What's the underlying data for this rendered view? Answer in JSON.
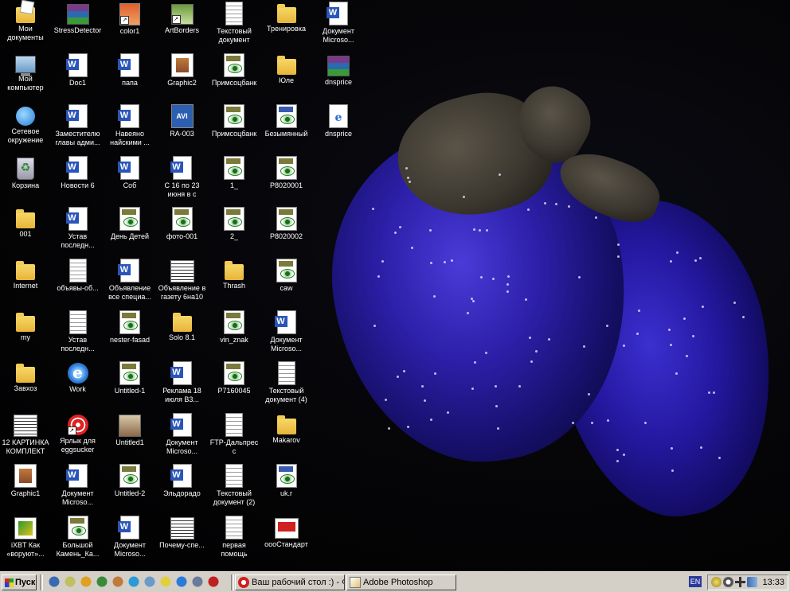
{
  "desktop": {
    "icons": [
      {
        "label": "Мои документы",
        "icon": "my-documents-icon"
      },
      {
        "label": "Мой компьютер",
        "icon": "my-computer-icon"
      },
      {
        "label": "Сетевое окружение",
        "icon": "network-places-icon"
      },
      {
        "label": "Корзина",
        "icon": "recycle-bin-icon"
      },
      {
        "label": "001",
        "icon": "folder-icon"
      },
      {
        "label": "Internet",
        "icon": "folder-icon"
      },
      {
        "label": "my",
        "icon": "folder-icon"
      },
      {
        "label": "Завхоз",
        "icon": "folder-icon"
      },
      {
        "label": "12 КАРТИНКА КОМПЛЕКТ",
        "icon": "image-file-icon"
      },
      {
        "label": "Graphic1",
        "icon": "photoshop-file-icon"
      },
      {
        "label": "iXBT Как «воруют»...",
        "icon": "ixbt-file-icon"
      },
      {
        "label": "StressDetector",
        "icon": "winrar-archive-icon"
      },
      {
        "label": "Doc1",
        "icon": "word-document-icon"
      },
      {
        "label": "Заместителю главы адми...",
        "icon": "word-document-icon"
      },
      {
        "label": "Новости 6",
        "icon": "word-document-icon"
      },
      {
        "label": "Устав последн...",
        "icon": "word-document-icon"
      },
      {
        "label": "объявы-об...",
        "icon": "text-document-icon"
      },
      {
        "label": "Устав последн...",
        "icon": "text-document-icon"
      },
      {
        "label": "Work",
        "icon": "internet-explorer-icon"
      },
      {
        "label": "Ярлык для eggsucker",
        "icon": "ball-shortcut-icon"
      },
      {
        "label": "Документ Microso...",
        "icon": "word-document-icon"
      },
      {
        "label": "Большой Камень_Ка...",
        "icon": "tiff-image-icon"
      },
      {
        "label": "color1",
        "icon": "color-file-icon"
      },
      {
        "label": "папа",
        "icon": "word-document-icon"
      },
      {
        "label": "Навеяно найскими ...",
        "icon": "word-document-icon"
      },
      {
        "label": "Соб",
        "icon": "word-document-icon"
      },
      {
        "label": "День Детей",
        "icon": "tiff-image-icon"
      },
      {
        "label": "Объявление все специа...",
        "icon": "word-document-icon"
      },
      {
        "label": "nester-fasad",
        "icon": "tiff-image-icon"
      },
      {
        "label": "Untitled-1",
        "icon": "psd-image-icon"
      },
      {
        "label": "Untitled1",
        "icon": "project-file-icon"
      },
      {
        "label": "Untitled-2",
        "icon": "psd-image-icon"
      },
      {
        "label": "Документ Microso...",
        "icon": "word-document-icon"
      },
      {
        "label": "ArtBorders",
        "icon": "artborders-shortcut-icon"
      },
      {
        "label": "Graphic2",
        "icon": "photoshop-file-icon"
      },
      {
        "label": "RA-003",
        "icon": "avi-video-icon"
      },
      {
        "label": "С 16 по 23 июня в с",
        "icon": "word-document-icon"
      },
      {
        "label": "фото-001",
        "icon": "tiff-image-icon"
      },
      {
        "label": "Объявление в газету 6на10",
        "icon": "scanned-page-icon"
      },
      {
        "label": "Solo 8.1",
        "icon": "folder-icon"
      },
      {
        "label": "Реклама 18 июля В3...",
        "icon": "word-document-icon"
      },
      {
        "label": "Документ Microso...",
        "icon": "word-document-icon"
      },
      {
        "label": "Эльдорадо",
        "icon": "word-document-icon"
      },
      {
        "label": "Почему-спе...",
        "icon": "scanned-page-icon"
      },
      {
        "label": "Текстовый документ",
        "icon": "text-document-icon"
      },
      {
        "label": "Примсоцбанк",
        "icon": "tiff-image-icon"
      },
      {
        "label": "Примсоцбанк",
        "icon": "jpeg-image-icon"
      },
      {
        "label": "1_",
        "icon": "jpeg-image-icon"
      },
      {
        "label": "2_",
        "icon": "jpeg-image-icon"
      },
      {
        "label": "Thrash",
        "icon": "folder-icon"
      },
      {
        "label": "vin_znak",
        "icon": "jpeg-image-icon"
      },
      {
        "label": "P7160045",
        "icon": "tiff-image-icon"
      },
      {
        "label": "FTP-Дальпрес с",
        "icon": "text-document-icon"
      },
      {
        "label": "Текстовый документ (2)",
        "icon": "text-document-icon"
      },
      {
        "label": "первая помощь",
        "icon": "text-document-icon"
      },
      {
        "label": "Тренировка",
        "icon": "folder-icon"
      },
      {
        "label": "Юле",
        "icon": "folder-icon"
      },
      {
        "label": "Безымянный",
        "icon": "bmp-image-icon"
      },
      {
        "label": "P8020001",
        "icon": "jpeg-image-icon"
      },
      {
        "label": "P8020002",
        "icon": "jpeg-image-icon"
      },
      {
        "label": "caw",
        "icon": "psd-image-icon"
      },
      {
        "label": "Документ Microso...",
        "icon": "word-document-icon"
      },
      {
        "label": "Текстовый документ (4)",
        "icon": "text-document-icon"
      },
      {
        "label": "Makarov",
        "icon": "folder-icon"
      },
      {
        "label": "uk.r",
        "icon": "bmp-image-icon"
      },
      {
        "label": "оооСтандарт",
        "icon": "red-image-icon"
      },
      {
        "label": "Документ Microso...",
        "icon": "word-document-icon"
      },
      {
        "label": "dnsprice",
        "icon": "winrar-archive-icon"
      },
      {
        "label": "dnsprice",
        "icon": "html-document-icon"
      }
    ]
  },
  "taskbar": {
    "start_label": "Пуск",
    "quick_launch": [
      "media-player-icon",
      "pencil-icon",
      "pen-icon",
      "app-icon",
      "photoshop-icon",
      "star-icon",
      "image-viewer-icon",
      "outlook-icon",
      "internet-explorer-icon",
      "notepad-icon",
      "acrobat-icon"
    ],
    "tasks": [
      {
        "label": "Ваш рабочий стол :) - Ф...",
        "icon": "opera-icon"
      },
      {
        "label": "Adobe Photoshop",
        "icon": "photoshop-icon"
      }
    ],
    "language": "EN",
    "tray_icons": [
      "shield-icon",
      "clock-icon",
      "network-icon",
      "volume-icon"
    ],
    "clock": "13:33"
  }
}
